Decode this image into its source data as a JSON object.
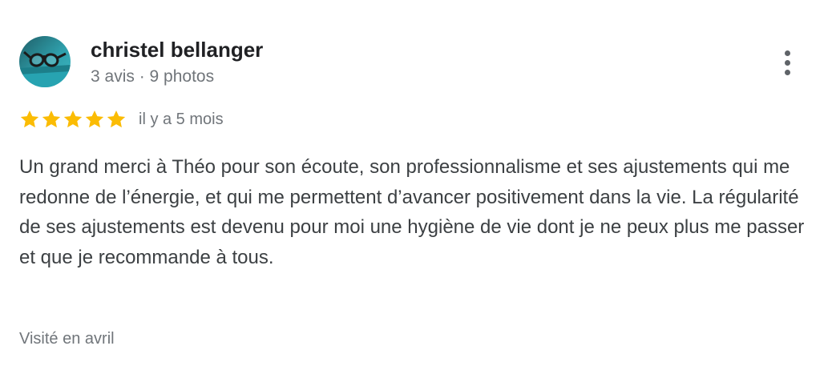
{
  "review": {
    "reviewer_name": "christel bellanger",
    "reviewer_meta": "3 avis · 9 photos",
    "rating": 5,
    "rating_max": 5,
    "date": "il y a 5 mois",
    "text": "Un grand merci à Théo pour son écoute, son professionnalisme et ses ajustements qui me redonne de l’énergie, et qui me permettent d’avancer positivement dans la vie. La régularité de ses ajustements est devenu pour moi une hygiène de vie dont je ne peux plus me passer et que je recommande à tous.",
    "visit": "Visité en avril"
  },
  "icons": {
    "avatar": "avatar-photo-glasses",
    "menu": "more-vertical-icon",
    "star": "star-icon"
  },
  "colors": {
    "star": "#fbbc04",
    "name": "#202124",
    "meta": "#70757a",
    "body_text": "#3c4043",
    "menu_dots": "#5f6368",
    "avatar_teal": "#2ba6b4"
  }
}
